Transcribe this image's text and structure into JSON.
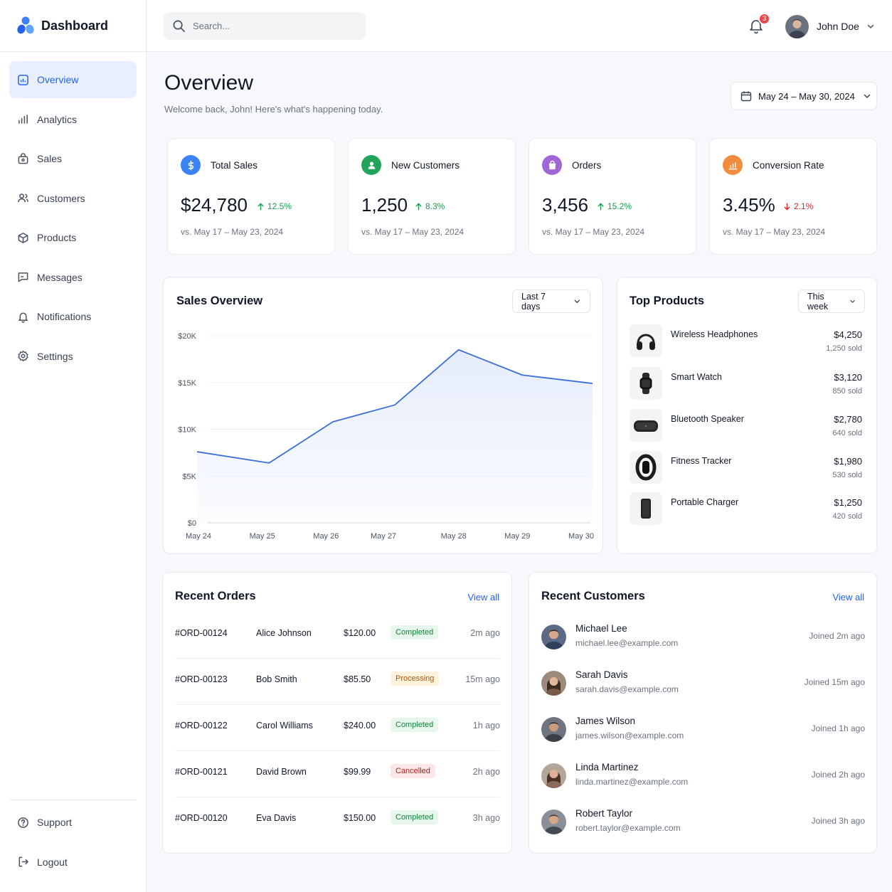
{
  "brand": {
    "name": "Dashboard",
    "accent": "#2563eb"
  },
  "sidebar": {
    "items": [
      {
        "label": "Overview",
        "icon": "overview-icon",
        "active": true
      },
      {
        "label": "Analytics",
        "icon": "analytics-icon"
      },
      {
        "label": "Sales",
        "icon": "sales-bag-icon"
      },
      {
        "label": "Customers",
        "icon": "customers-icon"
      },
      {
        "label": "Products",
        "icon": "box-icon"
      },
      {
        "label": "Messages",
        "icon": "message-icon"
      },
      {
        "label": "Notifications",
        "icon": "bell-icon"
      },
      {
        "label": "Settings",
        "icon": "gear-icon"
      }
    ],
    "bottom": [
      {
        "label": "Support",
        "icon": "help-icon"
      },
      {
        "label": "Logout",
        "icon": "logout-icon"
      }
    ]
  },
  "topbar": {
    "search_placeholder": "Search...",
    "notification_count": "3",
    "user_name": "John Doe"
  },
  "header": {
    "title": "Overview",
    "subtitle": "Welcome back, John! Here's what's happening today.",
    "date_range": "May 24 – May 30, 2024"
  },
  "stats": [
    {
      "label": "Total Sales",
      "value": "$24,780",
      "change": "12.5%",
      "direction": "up",
      "compare": "vs. May 17 – May 23, 2024",
      "color": "#3b82f6",
      "icon": "dollar-icon"
    },
    {
      "label": "New Customers",
      "value": "1,250",
      "change": "8.3%",
      "direction": "up",
      "compare": "vs. May 17 – May 23, 2024",
      "color": "#22a55a",
      "icon": "user-icon"
    },
    {
      "label": "Orders",
      "value": "3,456",
      "change": "15.2%",
      "direction": "up",
      "compare": "vs. May 17 – May 23, 2024",
      "color": "#a066d6",
      "icon": "shopping-bag-icon"
    },
    {
      "label": "Conversion Rate",
      "value": "3.45%",
      "change": "2.1%",
      "direction": "down",
      "compare": "vs. May 17 – May 23, 2024",
      "color": "#f28b3c",
      "icon": "chart-icon"
    }
  ],
  "sales_overview": {
    "title": "Sales Overview",
    "filter": "Last 7 days"
  },
  "chart_data": {
    "type": "area",
    "categories": [
      "May 24",
      "May 25",
      "May 26",
      "May 27",
      "May 28",
      "May 29",
      "May 30"
    ],
    "x_positions": [
      0,
      1,
      2,
      2.9,
      4,
      5,
      6
    ],
    "y_ticks": [
      "$0",
      "$5K",
      "$10K",
      "$15K",
      "$20K"
    ],
    "ylim": [
      0,
      20000
    ],
    "series": [
      {
        "x": [
          0,
          1.13,
          2.13,
          3.1,
          4.1,
          5.1,
          6.2
        ],
        "values": [
          7600,
          6400,
          10800,
          12600,
          18500,
          15800,
          14900
        ]
      }
    ],
    "line_color": "#3b6fd8",
    "fill_color": "#e5ecfb",
    "grid": true
  },
  "top_products": {
    "title": "Top Products",
    "filter": "This week",
    "items": [
      {
        "name": "Wireless Headphones",
        "amount": "$4,250",
        "sold": "1,250 sold",
        "icon": "headphones-icon"
      },
      {
        "name": "Smart Watch",
        "amount": "$3,120",
        "sold": "850 sold",
        "icon": "smartwatch-icon"
      },
      {
        "name": "Bluetooth Speaker",
        "amount": "$2,780",
        "sold": "640 sold",
        "icon": "speaker-icon"
      },
      {
        "name": "Fitness Tracker",
        "amount": "$1,980",
        "sold": "530 sold",
        "icon": "fitness-tracker-icon"
      },
      {
        "name": "Portable Charger",
        "amount": "$1,250",
        "sold": "420 sold",
        "icon": "power-bank-icon"
      }
    ]
  },
  "recent_orders": {
    "title": "Recent Orders",
    "view_all": "View all",
    "rows": [
      {
        "id": "#ORD-00124",
        "customer": "Alice Johnson",
        "amount": "$120.00",
        "status": "Completed",
        "time": "2m ago"
      },
      {
        "id": "#ORD-00123",
        "customer": "Bob Smith",
        "amount": "$85.50",
        "status": "Processing",
        "time": "15m ago"
      },
      {
        "id": "#ORD-00122",
        "customer": "Carol Williams",
        "amount": "$240.00",
        "status": "Completed",
        "time": "1h ago"
      },
      {
        "id": "#ORD-00121",
        "customer": "David Brown",
        "amount": "$99.99",
        "status": "Cancelled",
        "time": "2h ago"
      },
      {
        "id": "#ORD-00120",
        "customer": "Eva Davis",
        "amount": "$150.00",
        "status": "Completed",
        "time": "3h ago"
      }
    ]
  },
  "recent_customers": {
    "title": "Recent Customers",
    "view_all": "View all",
    "rows": [
      {
        "name": "Michael Lee",
        "email": "michael.lee@example.com",
        "joined": "Joined 2m ago"
      },
      {
        "name": "Sarah Davis",
        "email": "sarah.davis@example.com",
        "joined": "Joined 15m ago"
      },
      {
        "name": "James Wilson",
        "email": "james.wilson@example.com",
        "joined": "Joined 1h ago"
      },
      {
        "name": "Linda Martinez",
        "email": "linda.martinez@example.com",
        "joined": "Joined 2h ago"
      },
      {
        "name": "Robert Taylor",
        "email": "robert.taylor@example.com",
        "joined": "Joined 3h ago"
      }
    ]
  }
}
